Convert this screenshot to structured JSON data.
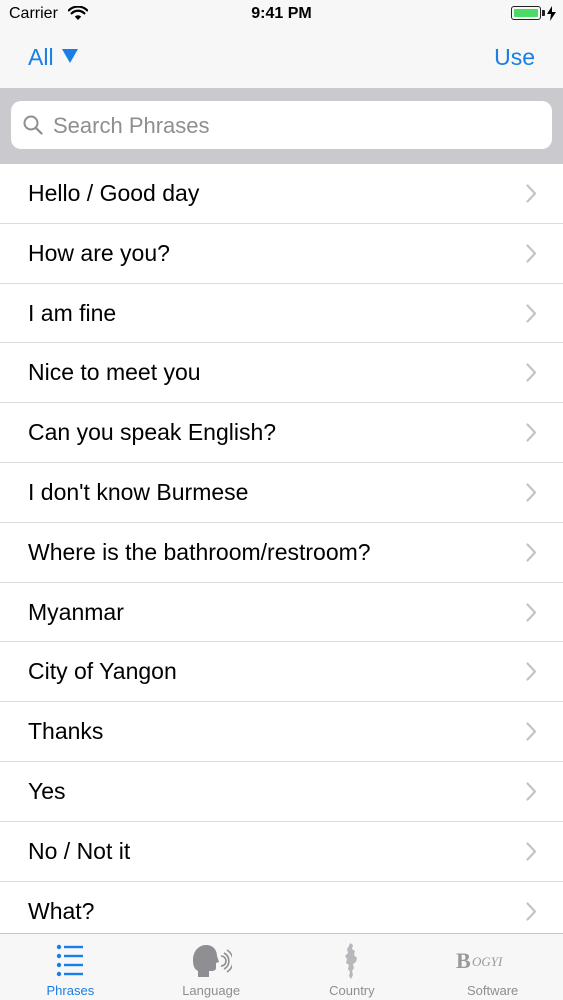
{
  "status_bar": {
    "carrier": "Carrier",
    "time": "9:41 PM"
  },
  "nav": {
    "filter_label": "All",
    "filter_icon": "triangle-down-icon",
    "action_label": "Use"
  },
  "search": {
    "placeholder": "Search Phrases",
    "value": ""
  },
  "phrases": [
    "Hello / Good day",
    "How are you?",
    "I am fine",
    "Nice to meet you",
    "Can you speak English?",
    "I don't know Burmese",
    "Where is the bathroom/restroom?",
    "Myanmar",
    "City of Yangon",
    "Thanks",
    "Yes",
    "No / Not it",
    "What?"
  ],
  "tabs": [
    {
      "label": "Phrases",
      "icon": "list-icon",
      "active": true
    },
    {
      "label": "Language",
      "icon": "speaking-head-icon",
      "active": false
    },
    {
      "label": "Country",
      "icon": "country-map-icon",
      "active": false
    },
    {
      "label": "Software",
      "icon": "bogyi-logo-icon",
      "active": false
    }
  ],
  "colors": {
    "accent": "#1a7ee8",
    "inactive": "#8e8e93",
    "search_bg": "#c9c9ce"
  }
}
